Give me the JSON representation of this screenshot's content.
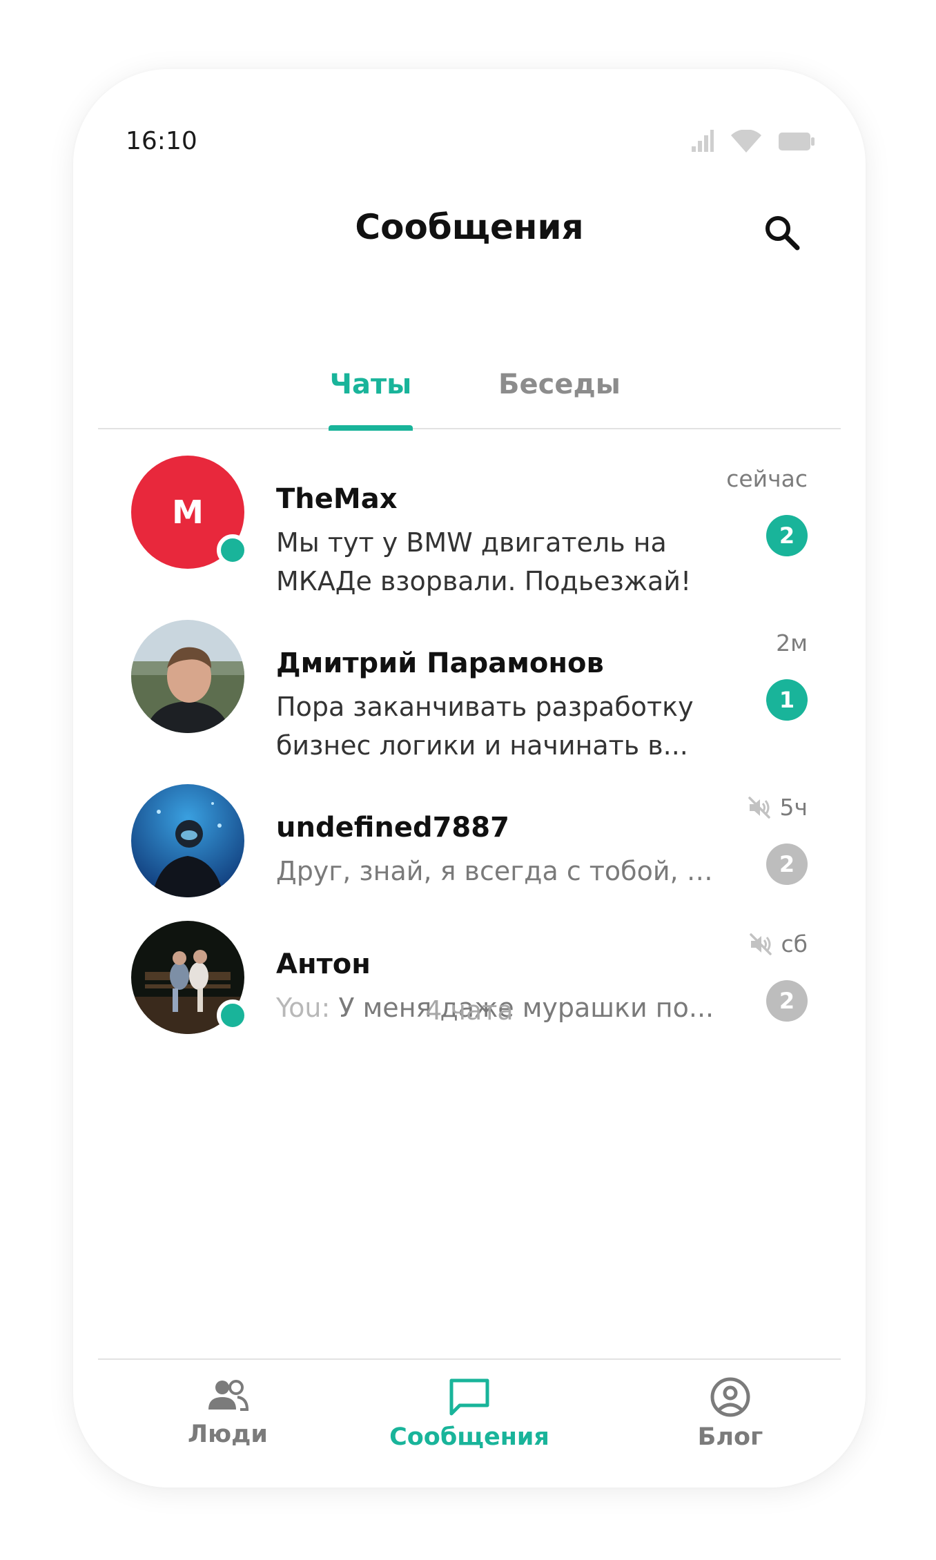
{
  "status_bar": {
    "time": "16:10",
    "icons": [
      "cellular-signal-icon",
      "wifi-icon",
      "battery-icon"
    ]
  },
  "header": {
    "title": "Сообщения",
    "search_icon": "search-icon"
  },
  "tabs": [
    {
      "label": "Чаты",
      "active": true
    },
    {
      "label": "Беседы",
      "active": false
    }
  ],
  "chats": [
    {
      "name": "TheMax",
      "avatar_letter": "M",
      "avatar_color": "#e8283c",
      "online": true,
      "message_line1": "Мы тут у BMW двигатель на",
      "message_line2": "МКАДе взорвали. Подьезжай!",
      "time": "сейчас",
      "unread": "2",
      "muted": false
    },
    {
      "name": "Дмитрий Парамонов",
      "online": false,
      "message_line1": "Пора заканчивать разработку",
      "message_line2": "бизнес логики и начинать в...",
      "time": "2м",
      "unread": "1",
      "muted": false
    },
    {
      "name": "undefined7887",
      "online": false,
      "message": "Друг, знай, я всегда с тобой, ч...",
      "time": "5ч",
      "unread": "2",
      "muted": true
    },
    {
      "name": "Антон",
      "online": true,
      "message_prefix": "You:",
      "message": "У меня даже мурашки по...",
      "time": "сб",
      "unread": "2",
      "muted": true
    }
  ],
  "chat_count": "4 чата",
  "bottom_nav": [
    {
      "label": "Люди",
      "icon": "people-icon",
      "active": false
    },
    {
      "label": "Сообщения",
      "icon": "chat-bubble-icon",
      "active": true
    },
    {
      "label": "Блог",
      "icon": "profile-circle-icon",
      "active": false
    }
  ],
  "colors": {
    "accent": "#19b49a",
    "avatar_red": "#e8283c",
    "muted_badge": "#bdbdbd"
  }
}
